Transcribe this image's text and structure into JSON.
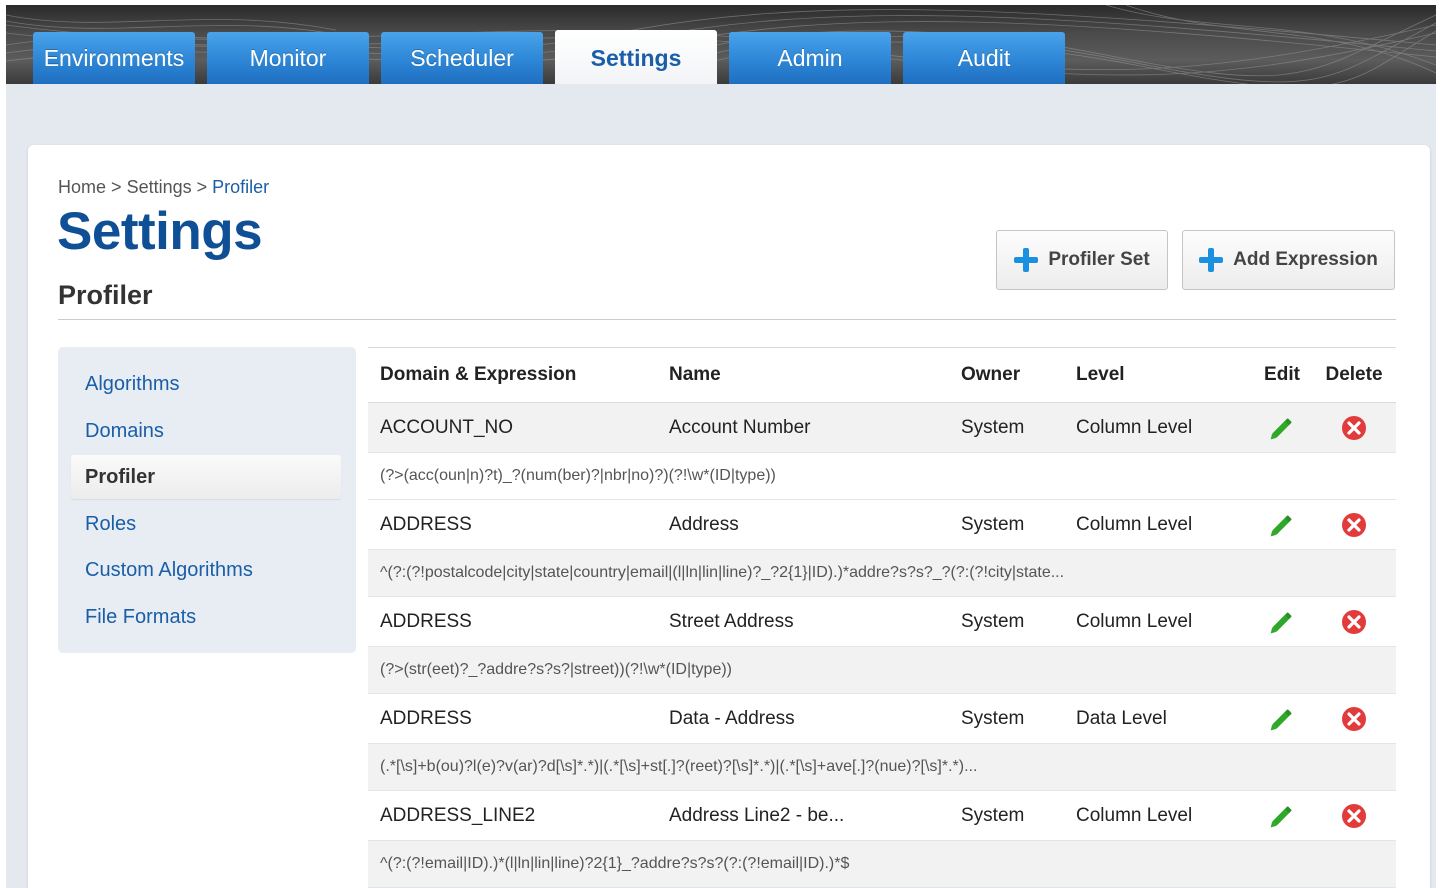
{
  "nav": {
    "tabs": [
      {
        "label": "Environments"
      },
      {
        "label": "Monitor"
      },
      {
        "label": "Scheduler"
      },
      {
        "label": "Settings"
      },
      {
        "label": "Admin"
      },
      {
        "label": "Audit"
      }
    ],
    "active_tab": "Settings"
  },
  "breadcrumb": {
    "home": "Home",
    "sep1": ">",
    "settings": "Settings",
    "sep2": ">",
    "current": "Profiler"
  },
  "page": {
    "title": "Settings",
    "section": "Profiler"
  },
  "actions": {
    "profiler_set": "Profiler Set",
    "add_expression": "Add Expression"
  },
  "sidebar": {
    "items": [
      {
        "label": "Algorithms"
      },
      {
        "label": "Domains"
      },
      {
        "label": "Profiler"
      },
      {
        "label": "Roles"
      },
      {
        "label": "Custom Algorithms"
      },
      {
        "label": "File Formats"
      }
    ],
    "active": "Profiler"
  },
  "table": {
    "headers": {
      "domain": "Domain & Expression",
      "name": "Name",
      "owner": "Owner",
      "level": "Level",
      "edit": "Edit",
      "delete": "Delete"
    },
    "rows": [
      {
        "domain": "ACCOUNT_NO",
        "name": "Account Number",
        "owner": "System",
        "level": "Column Level",
        "expression": "(?>(acc(oun|n)?t)_?(num(ber)?|nbr|no)?)(?!\\w*(ID|type))"
      },
      {
        "domain": "ADDRESS",
        "name": "Address",
        "owner": "System",
        "level": "Column Level",
        "expression": "^(?:(?!postalcode|city|state|country|email|(l|ln|lin|line)?_?2{1}|ID).)*addre?s?s?_?(?:(?!city|state..."
      },
      {
        "domain": "ADDRESS",
        "name": "Street Address",
        "owner": "System",
        "level": "Column Level",
        "expression": "(?>(str(eet)?_?addre?s?s?|street))(?!\\w*(ID|type))"
      },
      {
        "domain": "ADDRESS",
        "name": "Data - Address",
        "owner": "System",
        "level": "Data Level",
        "expression": "(.*[\\s]+b(ou)?l(e)?v(ar)?d[\\s]*.*)|(.*[\\s]+st[.]?(reet)?[\\s]*.*)|(.*[\\s]+ave[.]?(nue)?[\\s]*.*)..."
      },
      {
        "domain": "ADDRESS_LINE2",
        "name": "Address Line2 - be...",
        "owner": "System",
        "level": "Column Level",
        "expression": "^(?:(?!email|ID).)*(l|ln|lin|line)?2{1}_?addre?s?s?(?:(?!email|ID).)*$"
      }
    ]
  },
  "colors": {
    "accent": "#1a5ea8",
    "tab_blue": "#2d86d6",
    "edit_green": "#2fa829",
    "delete_red": "#e23b3b",
    "plus_blue": "#1b8fe0"
  },
  "icons": {
    "edit": "pencil-icon",
    "delete": "delete-circle-icon",
    "add": "plus-icon"
  }
}
